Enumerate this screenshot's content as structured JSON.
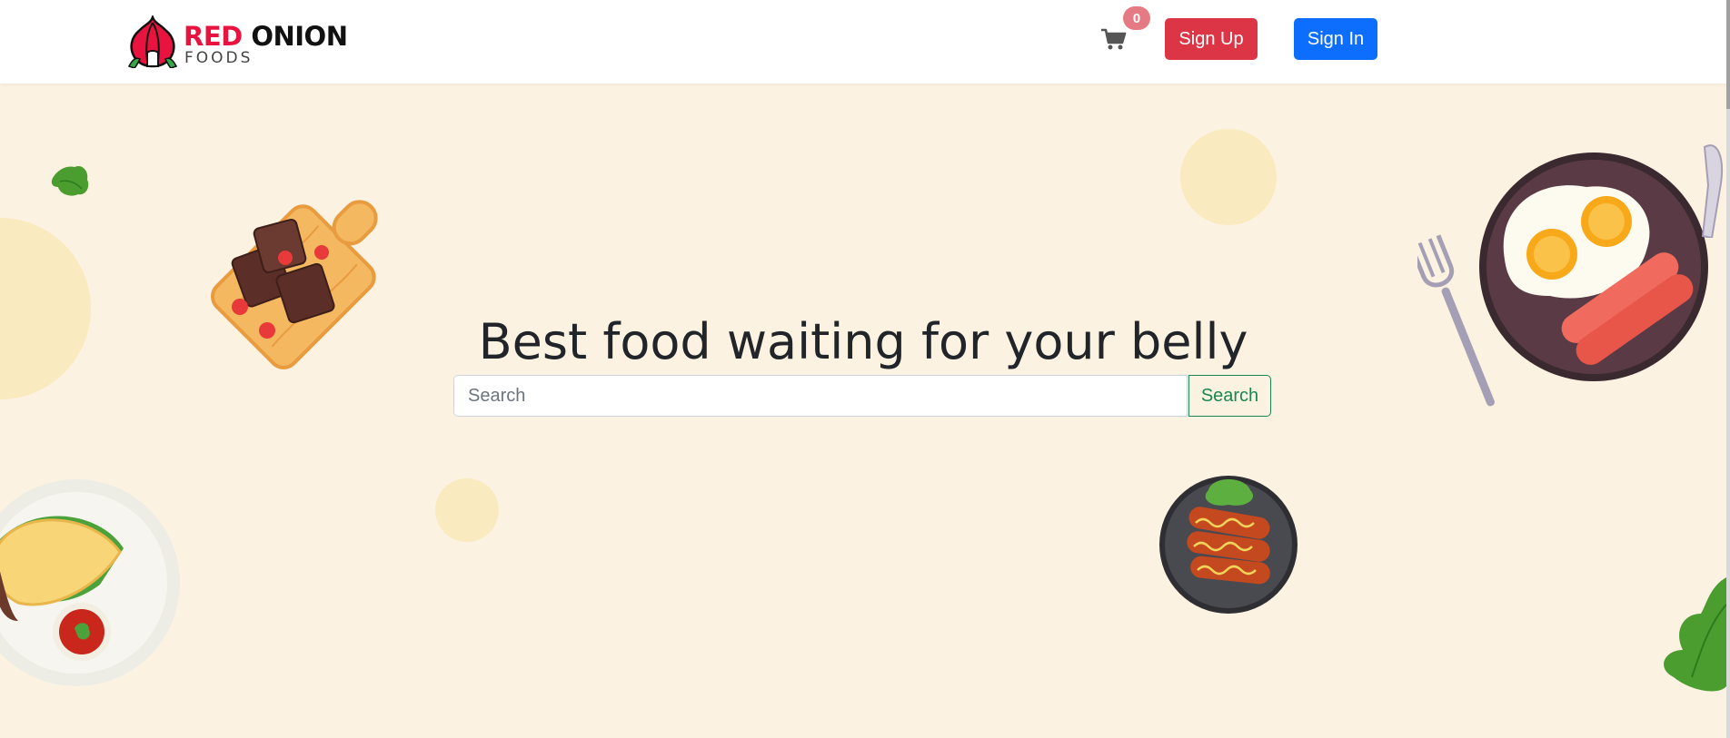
{
  "navbar": {
    "logo": {
      "primary_red": "RED",
      "primary_dark": "ONION",
      "secondary": "FOODS"
    },
    "cart": {
      "icon": "cart-icon",
      "count": "0"
    },
    "sign_up_label": "Sign Up",
    "sign_in_label": "Sign In"
  },
  "hero": {
    "headline": "Best food waiting for your belly",
    "search": {
      "placeholder": "Search",
      "value": "",
      "button_label": "Search"
    },
    "illustrations": [
      "lettuce-leaf-icon",
      "brownie-board-image",
      "eggs-sausage-plate-image",
      "fork-icon",
      "knife-icon",
      "taco-plate-image",
      "sausage-plate-image",
      "lettuce-image"
    ]
  },
  "colors": {
    "brand_red": "#e8133f",
    "hero_bg": "#fcf2e1",
    "signup_btn": "#dc3545",
    "signin_btn": "#0d6efd",
    "search_btn": "#198754",
    "badge": "#e67a84"
  }
}
